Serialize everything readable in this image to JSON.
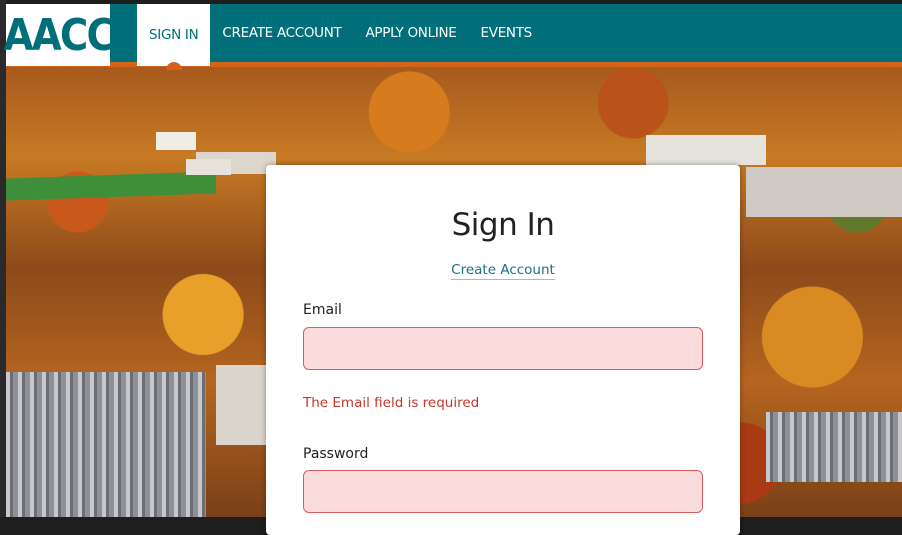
{
  "header": {
    "logo_text": "AACC",
    "nav": [
      {
        "label": "SIGN IN",
        "active": true
      },
      {
        "label": "CREATE ACCOUNT",
        "active": false
      },
      {
        "label": "APPLY ONLINE",
        "active": false
      },
      {
        "label": "EVENTS",
        "active": false
      }
    ]
  },
  "form": {
    "title": "Sign In",
    "create_account_link": "Create Account",
    "email_label": "Email",
    "email_value": "",
    "email_error": "The Email field is required",
    "password_label": "Password",
    "password_value": ""
  },
  "colors": {
    "brand_teal": "#006f7a",
    "accent_orange": "#d4631a",
    "error_red": "#c0392b",
    "error_fill": "#fbdcdc"
  }
}
